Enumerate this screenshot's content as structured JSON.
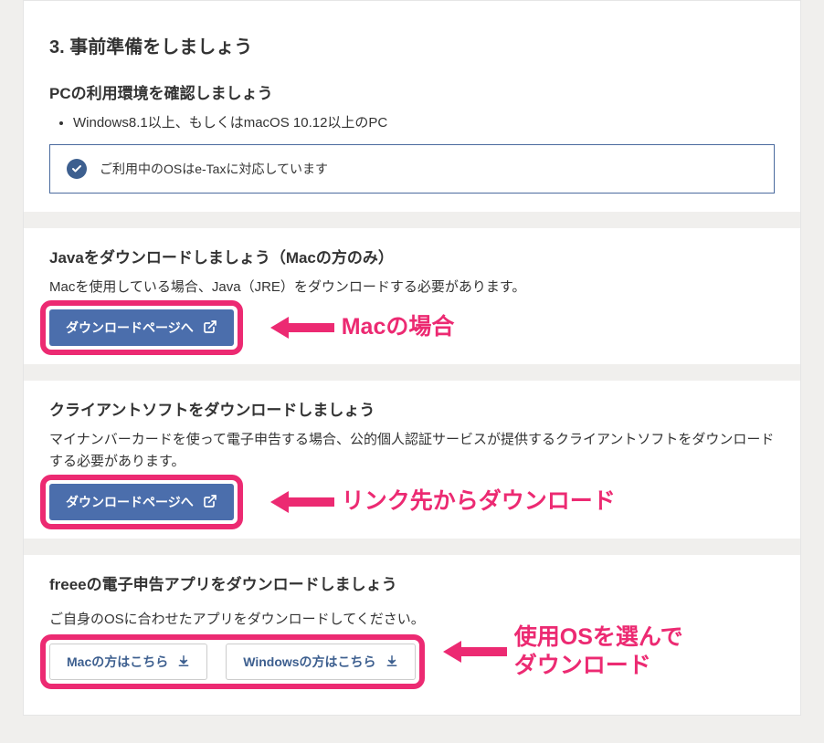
{
  "main": {
    "title": "3. 事前準備をしましょう"
  },
  "pc_env": {
    "title": "PCの利用環境を確認しましょう",
    "item1": "Windows8.1以上、もしくはmacOS 10.12以上のPC",
    "status": "ご利用中のOSはe-Taxに対応しています"
  },
  "java": {
    "title": "Javaをダウンロードしましょう（Macの方のみ）",
    "desc": "Macを使用している場合、Java（JRE）をダウンロードする必要があります。",
    "button": "ダウンロードページへ"
  },
  "client": {
    "title": "クライアントソフトをダウンロードしましょう",
    "desc": "マイナンバーカードを使って電子申告する場合、公的個人認証サービスが提供するクライアントソフトをダウンロードする必要があります。",
    "button": "ダウンロードページへ"
  },
  "freee": {
    "title": "freeeの電子申告アプリをダウンロードしましょう",
    "desc": "ご自身のOSに合わせたアプリをダウンロードしてください。",
    "mac_btn": "Macの方はこちら",
    "win_btn": "Windowsの方はこちら"
  },
  "annotations": {
    "mac": "Macの場合",
    "link": "リンク先からダウンロード",
    "os_line1": "使用OSを選んで",
    "os_line2": "ダウンロード"
  }
}
